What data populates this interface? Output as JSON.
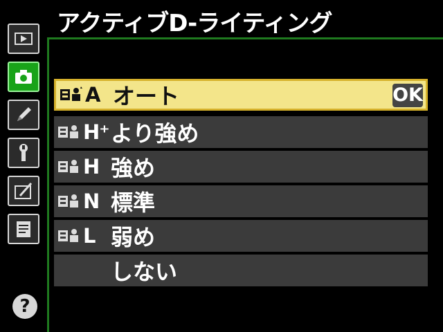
{
  "header": {
    "title": "アクティブD-ライティング"
  },
  "tabs": [
    {
      "name": "playback-menu-tab",
      "icon": "play-icon",
      "active": false
    },
    {
      "name": "shooting-menu-tab",
      "icon": "camera-icon",
      "active": true
    },
    {
      "name": "custom-settings-tab",
      "icon": "pencil-icon",
      "active": false
    },
    {
      "name": "setup-menu-tab",
      "icon": "wrench-icon",
      "active": false
    },
    {
      "name": "retouch-menu-tab",
      "icon": "retouch-icon",
      "active": false
    },
    {
      "name": "my-menu-tab",
      "icon": "list-icon",
      "active": false
    }
  ],
  "options": [
    {
      "code": "A",
      "label": "オート",
      "selected": true,
      "ok": "OK",
      "icon": "adl-icon"
    },
    {
      "code": "H⁺",
      "label": "より強め",
      "selected": false,
      "icon": "adl-icon"
    },
    {
      "code": "H",
      "label": "強め",
      "selected": false,
      "icon": "adl-icon"
    },
    {
      "code": "N",
      "label": "標準",
      "selected": false,
      "icon": "adl-icon"
    },
    {
      "code": "L",
      "label": "弱め",
      "selected": false,
      "icon": "adl-icon"
    },
    {
      "code": "",
      "label": "しない",
      "selected": false,
      "icon": ""
    }
  ],
  "help": {
    "label": "?"
  },
  "colors": {
    "accent_green": "#19a319",
    "selected_bg": "#f3e58a",
    "row_bg": "#3b3b3b"
  }
}
